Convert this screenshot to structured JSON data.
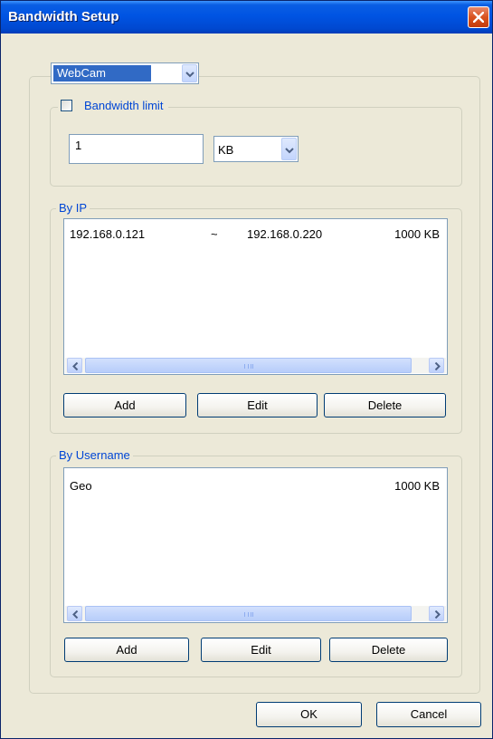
{
  "window": {
    "title": "Bandwidth Setup",
    "close_icon": "close-icon"
  },
  "device_select": {
    "value": "WebCam"
  },
  "bandwidth_limit": {
    "label": "Bandwidth limit",
    "checked": false,
    "amount": "1",
    "unit": "KB"
  },
  "by_ip": {
    "legend": "By IP",
    "rows": [
      {
        "start": "192.168.0.121",
        "sep": "~",
        "end": "192.168.0.220",
        "limit": "1000 KB"
      }
    ],
    "buttons": {
      "add": "Add",
      "edit": "Edit",
      "delete": "Delete"
    }
  },
  "by_username": {
    "legend": "By Username",
    "rows": [
      {
        "name": "Geo",
        "limit": "1000 KB"
      }
    ],
    "buttons": {
      "add": "Add",
      "edit": "Edit",
      "delete": "Delete"
    }
  },
  "footer": {
    "ok": "OK",
    "cancel": "Cancel"
  },
  "colors": {
    "titlebar": "#0054e3",
    "face": "#ece9d8",
    "legend_text": "#0046d5",
    "selection": "#316ac5"
  }
}
